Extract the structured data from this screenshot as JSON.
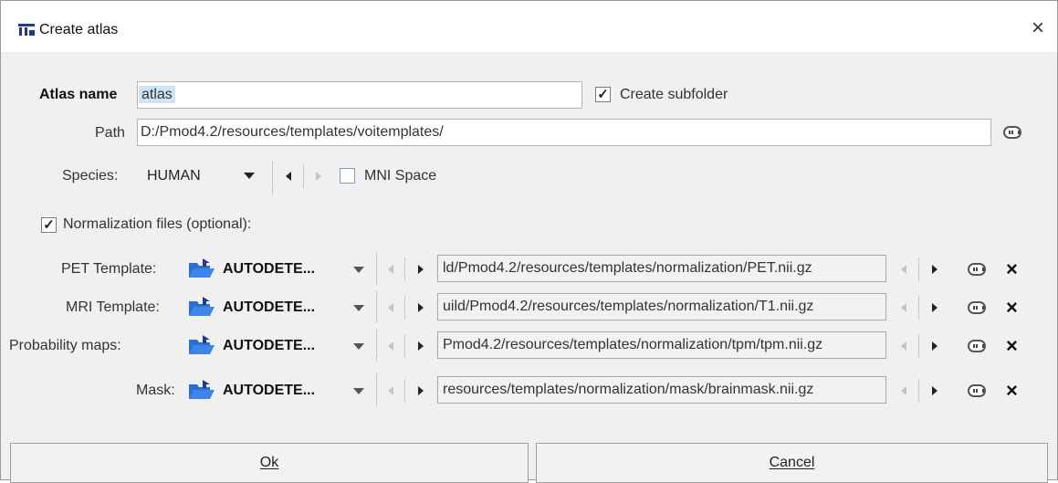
{
  "window": {
    "title": "Create atlas",
    "close_glyph": "×"
  },
  "atlas": {
    "name_label": "Atlas name",
    "name_value": "atlas",
    "create_subfolder_label": "Create subfolder",
    "create_subfolder_checked": true,
    "check_glyph": "✓"
  },
  "path": {
    "label": "Path",
    "value": "D:/Pmod4.2/resources/templates/voitemplates/"
  },
  "species": {
    "label": "Species:",
    "value": "HUMAN",
    "mni_label": "MNI Space",
    "mni_checked": false
  },
  "normalization": {
    "label": "Normalization files (optional):",
    "checked": true
  },
  "templates": [
    {
      "label": "PET Template:",
      "source": "AUTODETE...",
      "path": "ld/Pmod4.2/resources/templates/normalization/PET.nii.gz"
    },
    {
      "label": "MRI Template:",
      "source": "AUTODETE...",
      "path": "uild/Pmod4.2/resources/templates/normalization/T1.nii.gz"
    },
    {
      "label": "Probability maps:",
      "source": "AUTODETE...",
      "path": "Pmod4.2/resources/templates/normalization/tpm/tpm.nii.gz"
    },
    {
      "label": "Mask:",
      "source": "AUTODETE...",
      "path": "resources/templates/normalization/mask/brainmask.nii.gz"
    }
  ],
  "buttons": {
    "ok": "Ok",
    "cancel": "Cancel"
  },
  "colors": {
    "dialog_bg": "#f0f0f0",
    "field_bg": "#ffffff",
    "selection": "#cfe3f7",
    "folder_blue": "#2a6fd1"
  },
  "icons": {
    "title": "atlas-app-icon",
    "close": "close-icon",
    "folder": "folder-open-icon",
    "browse": "browse-icon",
    "clear": "clear-icon",
    "dropdown": "chevron-down-icon",
    "prev": "arrow-left-icon",
    "next": "arrow-right-icon"
  }
}
